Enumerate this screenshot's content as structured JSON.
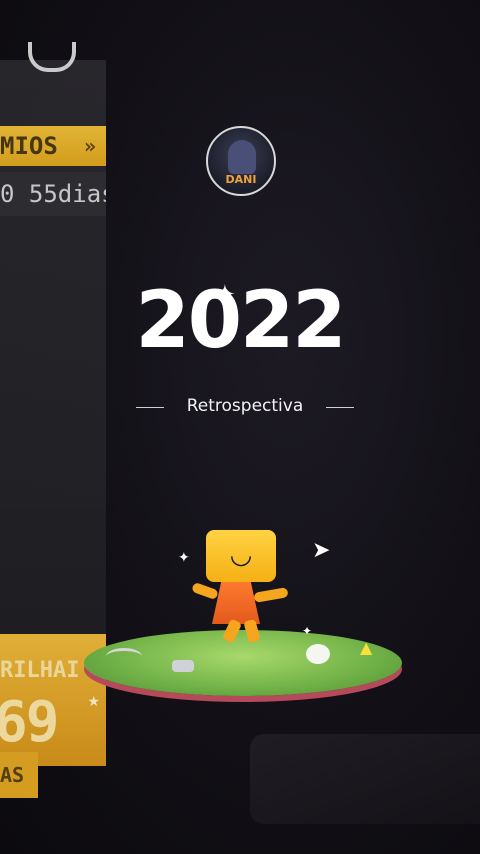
{
  "left_panel": {
    "premios_label": "MIOS",
    "premios_chevron": "»",
    "days_text": "0 55dias",
    "trilha_label": "RILHAI",
    "trilha_value": "69",
    "as_label": "AS"
  },
  "profile": {
    "avatar_name": "DANI"
  },
  "recap": {
    "year": "2022",
    "subtitle": "Retrospectiva"
  },
  "icons": {
    "sparkle": "✦",
    "plane": "➤",
    "star": "★"
  },
  "colors": {
    "accent": "#f2bd3a",
    "background": "#121016",
    "text": "#ffffff"
  }
}
